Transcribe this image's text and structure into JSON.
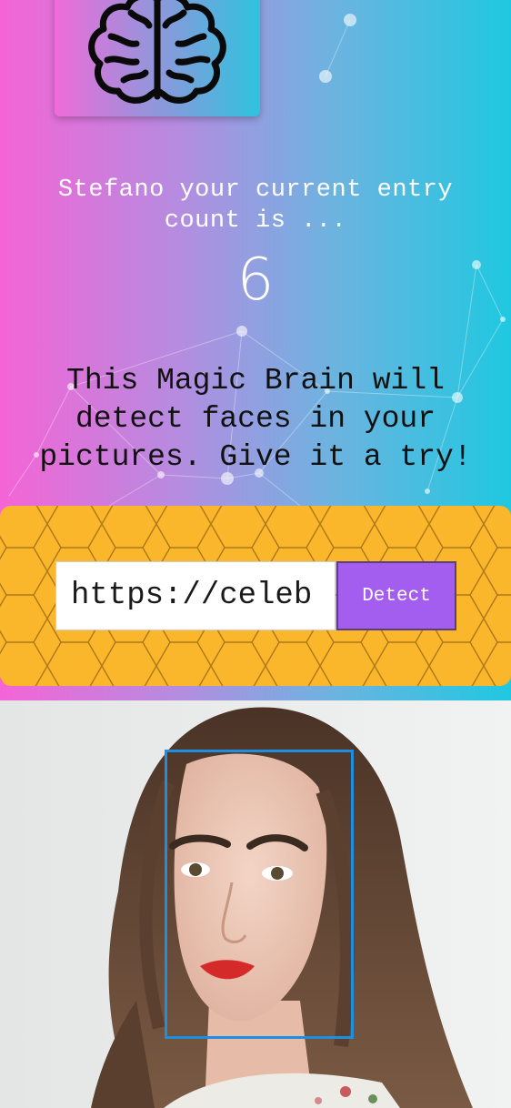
{
  "greeting": {
    "line1": "Stefano your current entry",
    "line2": "count is ..."
  },
  "entry_count": "6",
  "tagline": {
    "line1": "This Magic Brain will",
    "line2": "detect faces in your",
    "line3": "pictures. Give it a try!"
  },
  "form": {
    "url_value": "https://celeb",
    "detect_label": "Detect"
  },
  "colors": {
    "gradient_left": "#f564d6",
    "gradient_right": "#1fc8e0",
    "panel": "#fbb72b",
    "button": "#a45eef",
    "face_box": "#1d8fe3"
  },
  "icons": {
    "logo": "brain-icon"
  }
}
